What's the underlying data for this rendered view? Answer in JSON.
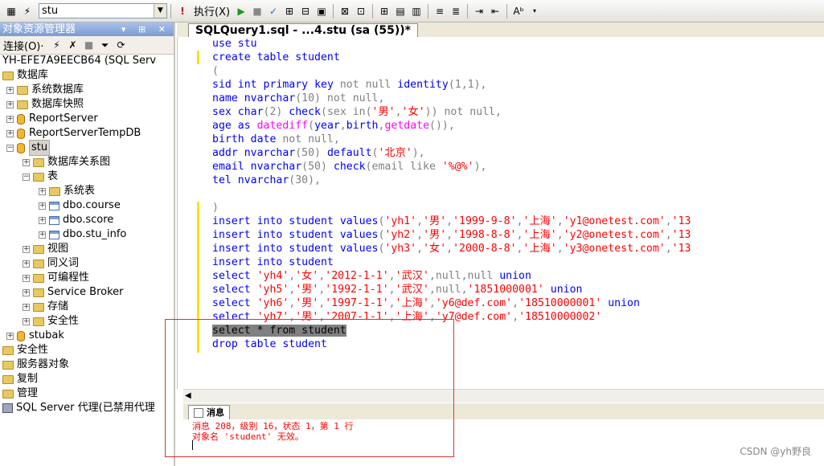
{
  "toolbar": {
    "database": "stu",
    "execute_label": "执行(X)"
  },
  "object_explorer": {
    "title": "对象资源管理器",
    "title_controls": "▾ ⊞ ✕",
    "connect_label": "连接(O)·",
    "tree": [
      {
        "label": "YH-EFE7A9EECB64 (SQL Serv",
        "depth": 0,
        "exp": "",
        "icon": "server-icon"
      },
      {
        "label": "数据库",
        "depth": 0,
        "exp": "",
        "icon": "folder-icon"
      },
      {
        "label": "系统数据库",
        "depth": 1,
        "exp": "+",
        "icon": "folder-icon"
      },
      {
        "label": "数据库快照",
        "depth": 1,
        "exp": "+",
        "icon": "folder-icon"
      },
      {
        "label": "ReportServer",
        "depth": 1,
        "exp": "+",
        "icon": "database-icon"
      },
      {
        "label": "ReportServerTempDB",
        "depth": 1,
        "exp": "+",
        "icon": "database-icon"
      },
      {
        "label": "stu",
        "depth": 1,
        "exp": "−",
        "icon": "database-icon",
        "selected": true
      },
      {
        "label": "数据库关系图",
        "depth": 2,
        "exp": "+",
        "icon": "folder-icon"
      },
      {
        "label": "表",
        "depth": 2,
        "exp": "−",
        "icon": "folder-icon"
      },
      {
        "label": "系统表",
        "depth": 3,
        "exp": "+",
        "icon": "folder-icon"
      },
      {
        "label": "dbo.course",
        "depth": 3,
        "exp": "+",
        "icon": "table-icon"
      },
      {
        "label": "dbo.score",
        "depth": 3,
        "exp": "+",
        "icon": "table-icon"
      },
      {
        "label": "dbo.stu_info",
        "depth": 3,
        "exp": "+",
        "icon": "table-icon"
      },
      {
        "label": "视图",
        "depth": 2,
        "exp": "+",
        "icon": "folder-icon"
      },
      {
        "label": "同义词",
        "depth": 2,
        "exp": "+",
        "icon": "folder-icon"
      },
      {
        "label": "可编程性",
        "depth": 2,
        "exp": "+",
        "icon": "folder-icon"
      },
      {
        "label": "Service Broker",
        "depth": 2,
        "exp": "+",
        "icon": "folder-icon"
      },
      {
        "label": "存储",
        "depth": 2,
        "exp": "+",
        "icon": "folder-icon"
      },
      {
        "label": "安全性",
        "depth": 2,
        "exp": "+",
        "icon": "folder-icon"
      },
      {
        "label": "stubak",
        "depth": 1,
        "exp": "+",
        "icon": "database-icon"
      },
      {
        "label": "安全性",
        "depth": 0,
        "exp": "",
        "icon": "folder-icon"
      },
      {
        "label": "服务器对象",
        "depth": 0,
        "exp": "",
        "icon": "folder-icon"
      },
      {
        "label": "复制",
        "depth": 0,
        "exp": "",
        "icon": "folder-icon"
      },
      {
        "label": "管理",
        "depth": 0,
        "exp": "",
        "icon": "folder-icon"
      },
      {
        "label": "SQL Server 代理(已禁用代理",
        "depth": 0,
        "exp": "",
        "icon": "agent-icon"
      }
    ]
  },
  "editor": {
    "tab_label": "SQLQuery1.sql - ...4.stu (sa (55))*",
    "lines": [
      [
        [
          "k",
          "use "
        ],
        [
          "k",
          "stu"
        ]
      ],
      [
        [
          "k",
          "create "
        ],
        [
          "k",
          "table "
        ],
        [
          "k",
          "student"
        ]
      ],
      [
        [
          "g",
          "("
        ]
      ],
      [
        [
          "k",
          "sid "
        ],
        [
          "k",
          "int "
        ],
        [
          "k",
          "primary "
        ],
        [
          "k",
          "key "
        ],
        [
          "g",
          "not null "
        ],
        [
          "k",
          "identity"
        ],
        [
          "g",
          "(1,1),"
        ]
      ],
      [
        [
          "k",
          "name "
        ],
        [
          "k",
          "nvarchar"
        ],
        [
          "g",
          "(10) not null,"
        ]
      ],
      [
        [
          "k",
          "sex "
        ],
        [
          "k",
          "char"
        ],
        [
          "g",
          "(2) "
        ],
        [
          "k",
          "check"
        ],
        [
          "g",
          "(sex in("
        ],
        [
          "s",
          "'男'"
        ],
        [
          "g",
          ","
        ],
        [
          "s",
          "'女'"
        ],
        [
          "g",
          ")) not null,"
        ]
      ],
      [
        [
          "k",
          "age "
        ],
        [
          "k",
          "as "
        ],
        [
          "f",
          "datediff"
        ],
        [
          "g",
          "("
        ],
        [
          "k",
          "year"
        ],
        [
          "g",
          ","
        ],
        [
          "k",
          "birth"
        ],
        [
          "g",
          ","
        ],
        [
          "f",
          "getdate"
        ],
        [
          "g",
          "()),"
        ]
      ],
      [
        [
          "k",
          "birth "
        ],
        [
          "k",
          "date "
        ],
        [
          "g",
          "not null,"
        ]
      ],
      [
        [
          "k",
          "addr "
        ],
        [
          "k",
          "nvarchar"
        ],
        [
          "g",
          "(50) "
        ],
        [
          "k",
          "default"
        ],
        [
          "g",
          "("
        ],
        [
          "s",
          "'北京'"
        ],
        [
          "g",
          "),"
        ]
      ],
      [
        [
          "k",
          "email "
        ],
        [
          "k",
          "nvarchar"
        ],
        [
          "g",
          "(50) "
        ],
        [
          "k",
          "check"
        ],
        [
          "g",
          "(email like "
        ],
        [
          "s",
          "'%@%'"
        ],
        [
          "g",
          "),"
        ]
      ],
      [
        [
          "k",
          "tel "
        ],
        [
          "k",
          "nvarchar"
        ],
        [
          "g",
          "(30),"
        ]
      ],
      [
        [
          "d",
          ""
        ]
      ],
      [
        [
          "g",
          ")"
        ]
      ],
      [
        [
          "k",
          "insert "
        ],
        [
          "k",
          "into "
        ],
        [
          "k",
          "student "
        ],
        [
          "k",
          "values"
        ],
        [
          "g",
          "("
        ],
        [
          "s",
          "'yh1'"
        ],
        [
          "g",
          ","
        ],
        [
          "s",
          "'男'"
        ],
        [
          "g",
          ","
        ],
        [
          "s",
          "'1999-9-8'"
        ],
        [
          "g",
          ","
        ],
        [
          "s",
          "'上海'"
        ],
        [
          "g",
          ","
        ],
        [
          "s",
          "'y1@onetest.com'"
        ],
        [
          "g",
          ","
        ],
        [
          "s",
          "'13"
        ]
      ],
      [
        [
          "k",
          "insert "
        ],
        [
          "k",
          "into "
        ],
        [
          "k",
          "student "
        ],
        [
          "k",
          "values"
        ],
        [
          "g",
          "("
        ],
        [
          "s",
          "'yh2'"
        ],
        [
          "g",
          ","
        ],
        [
          "s",
          "'男'"
        ],
        [
          "g",
          ","
        ],
        [
          "s",
          "'1998-8-8'"
        ],
        [
          "g",
          ","
        ],
        [
          "s",
          "'上海'"
        ],
        [
          "g",
          ","
        ],
        [
          "s",
          "'y2@onetest.com'"
        ],
        [
          "g",
          ","
        ],
        [
          "s",
          "'13"
        ]
      ],
      [
        [
          "k",
          "insert "
        ],
        [
          "k",
          "into "
        ],
        [
          "k",
          "student "
        ],
        [
          "k",
          "values"
        ],
        [
          "g",
          "("
        ],
        [
          "s",
          "'yh3'"
        ],
        [
          "g",
          ","
        ],
        [
          "s",
          "'女'"
        ],
        [
          "g",
          ","
        ],
        [
          "s",
          "'2000-8-8'"
        ],
        [
          "g",
          ","
        ],
        [
          "s",
          "'上海'"
        ],
        [
          "g",
          ","
        ],
        [
          "s",
          "'y3@onetest.com'"
        ],
        [
          "g",
          ","
        ],
        [
          "s",
          "'13"
        ]
      ],
      [
        [
          "k",
          "insert "
        ],
        [
          "k",
          "into "
        ],
        [
          "k",
          "student"
        ]
      ],
      [
        [
          "k",
          "select "
        ],
        [
          "s",
          "'yh4'"
        ],
        [
          "g",
          ","
        ],
        [
          "s",
          "'女'"
        ],
        [
          "g",
          ","
        ],
        [
          "s",
          "'2012-1-1'"
        ],
        [
          "g",
          ","
        ],
        [
          "s",
          "'武汉'"
        ],
        [
          "g",
          ",null,null "
        ],
        [
          "k",
          "union"
        ]
      ],
      [
        [
          "k",
          "select "
        ],
        [
          "s",
          "'yh5'"
        ],
        [
          "g",
          ","
        ],
        [
          "s",
          "'男'"
        ],
        [
          "g",
          ","
        ],
        [
          "s",
          "'1992-1-1'"
        ],
        [
          "g",
          ","
        ],
        [
          "s",
          "'武汉'"
        ],
        [
          "g",
          ",null,"
        ],
        [
          "s",
          "'1851000001' "
        ],
        [
          "k",
          "union"
        ]
      ],
      [
        [
          "k",
          "select "
        ],
        [
          "s",
          "'yh6'"
        ],
        [
          "g",
          ","
        ],
        [
          "s",
          "'男'"
        ],
        [
          "g",
          ","
        ],
        [
          "s",
          "'1997-1-1'"
        ],
        [
          "g",
          ","
        ],
        [
          "s",
          "'上海'"
        ],
        [
          "g",
          ","
        ],
        [
          "s",
          "'y6@def.com'"
        ],
        [
          "g",
          ","
        ],
        [
          "s",
          "'18510000001' "
        ],
        [
          "k",
          "union"
        ]
      ],
      [
        [
          "k",
          "select "
        ],
        [
          "s",
          "'yh7'"
        ],
        [
          "g",
          ","
        ],
        [
          "s",
          "'男'"
        ],
        [
          "g",
          ","
        ],
        [
          "s",
          "'2007-1-1'"
        ],
        [
          "g",
          ","
        ],
        [
          "s",
          "'上海'"
        ],
        [
          "g",
          ","
        ],
        [
          "s",
          "'y7@def.com'"
        ],
        [
          "g",
          ","
        ],
        [
          "s",
          "'18510000002'"
        ]
      ],
      [
        [
          "hl",
          "select * from student"
        ]
      ],
      [
        [
          "k",
          "drop "
        ],
        [
          "k",
          "table "
        ],
        [
          "k",
          "student"
        ]
      ]
    ]
  },
  "results": {
    "tab_label": "消息",
    "messages": [
      "消息 208，级别 16，状态 1，第 1 行",
      "对象名 'student' 无效。"
    ]
  },
  "watermark": "CSDN @yh野良"
}
